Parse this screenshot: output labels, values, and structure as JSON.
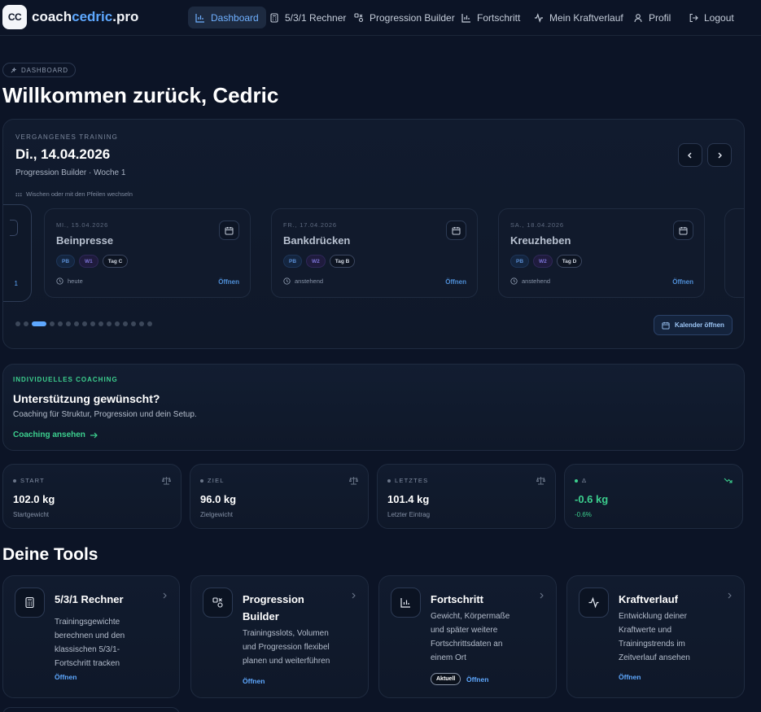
{
  "brand": {
    "mark": "CC",
    "name_prefix": "coach",
    "name_accent": "cedric",
    "name_suffix": ".pro"
  },
  "nav": [
    {
      "label": "Dashboard",
      "icon": "bar-chart-icon",
      "active": true
    },
    {
      "label": "5/3/1 Rechner",
      "icon": "calculator-icon"
    },
    {
      "label": "Progression Builder",
      "icon": "shapes-icon"
    },
    {
      "label": "Fortschritt",
      "icon": "bar-chart-icon"
    },
    {
      "label": "Mein Kraftverlauf",
      "icon": "activity-icon"
    },
    {
      "label": "Profil",
      "icon": "user-icon"
    },
    {
      "label": "Logout",
      "icon": "logout-icon"
    }
  ],
  "breadcrumb": "DASHBOARD",
  "page_title": "Willkommen zurück, Cedric",
  "training": {
    "kicker": "VERGANGENES TRAINING",
    "date": "Di., 14.04.2026",
    "subtitle": "Progression Builder · Woche 1",
    "hint": "Wischen oder mit den Pfeilen wechseln",
    "peek_left_label": "1",
    "sessions": [
      {
        "date": "MI., 15.04.2026",
        "title": "Beinpresse",
        "tags": [
          "PB",
          "W1",
          "Tag C"
        ],
        "status": "heute",
        "action": "Öffnen"
      },
      {
        "date": "FR., 17.04.2026",
        "title": "Bankdrücken",
        "tags": [
          "PB",
          "W2",
          "Tag B"
        ],
        "status": "anstehend",
        "action": "Öffnen"
      },
      {
        "date": "SA., 18.04.2026",
        "title": "Kreuzheben",
        "tags": [
          "PB",
          "W2",
          "Tag D"
        ],
        "status": "anstehend",
        "action": "Öffnen"
      }
    ],
    "dot_count": 16,
    "active_dot": 2,
    "calendar_button": "Kalender öffnen"
  },
  "coaching": {
    "kicker": "INDIVIDUELLES COACHING",
    "title": "Unterstützung gewünscht?",
    "subtitle": "Coaching für Struktur, Progression und dein Setup.",
    "link": "Coaching ansehen"
  },
  "stats": [
    {
      "label": "START",
      "value": "102.0 kg",
      "sub": "Startgewicht",
      "icon": "scale-icon",
      "accent": false
    },
    {
      "label": "ZIEL",
      "value": "96.0 kg",
      "sub": "Zielgewicht",
      "icon": "scale-icon",
      "accent": false
    },
    {
      "label": "LETZTES",
      "value": "101.4 kg",
      "sub": "Letzter Eintrag",
      "icon": "scale-icon",
      "accent": false
    },
    {
      "label": "Δ",
      "value": "-0.6 kg",
      "sub": "-0.6%",
      "icon": "trend-down-icon",
      "accent": true
    }
  ],
  "tools_title": "Deine Tools",
  "tools": [
    {
      "title": "5/3/1 Rechner",
      "desc": [
        "Trainingsgewichte",
        "berechnen und den",
        "klassischen 5/3/1-",
        "Fortschritt tracken"
      ],
      "action": "Öffnen",
      "badge": "",
      "icon": "calculator-icon"
    },
    {
      "title": "Progression Builder",
      "desc": [
        "Trainingsslots, Volumen",
        "und Progression flexibel",
        "planen und weiterführen"
      ],
      "action": "Öffnen",
      "badge": "",
      "icon": "shapes-icon"
    },
    {
      "title": "Fortschritt",
      "desc": [
        "Gewicht, Körpermaße",
        "und später weitere",
        "Fortschrittsdaten an",
        "einem Ort"
      ],
      "action": "Öffnen",
      "badge": "Aktuell",
      "icon": "bar-chart-icon"
    },
    {
      "title": "Kraftverlauf",
      "desc": [
        "Entwicklung deiner",
        "Kraftwerte und",
        "Trainingstrends im",
        "Zeitverlauf ansehen"
      ],
      "action": "Öffnen",
      "badge": "",
      "icon": "activity-icon"
    }
  ],
  "colors": {
    "background": "#0c1426",
    "accent_blue": "#5ea8ff",
    "accent_green": "#3ccf8e"
  }
}
